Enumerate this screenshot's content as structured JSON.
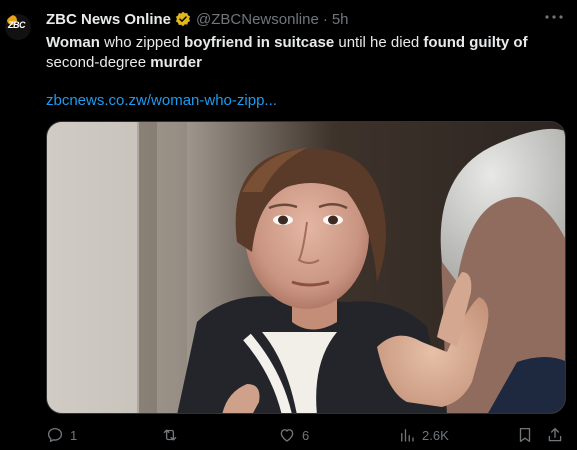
{
  "account": {
    "name": "ZBC News Online",
    "handle": "@ZBCNewsonline",
    "separator": "·",
    "time": "5h",
    "avatar_text": "ZBC"
  },
  "tweet": {
    "t1": "Woman",
    "t2": " who zipped ",
    "t3": "boyfriend in suitcase",
    "t4": " until he died ",
    "t5": "found guilty of",
    "t6": "second-degree ",
    "t7": "murder",
    "link": "zbcnews.co.zw/woman-who-zipp..."
  },
  "actions": {
    "reply_count": "1",
    "retweet_count": "",
    "like_count": "6",
    "views_count": "2.6K"
  },
  "icons": {
    "verified": "verified-badge-icon",
    "more": "more-icon",
    "reply": "reply-icon",
    "retweet": "retweet-icon",
    "like": "like-icon",
    "views": "views-icon",
    "bookmark": "bookmark-icon",
    "share": "share-icon"
  },
  "colors": {
    "background": "#000000",
    "text": "#e7e9ea",
    "muted": "#71767b",
    "link": "#1d9bf0",
    "verified_gold": "#e2b719"
  }
}
